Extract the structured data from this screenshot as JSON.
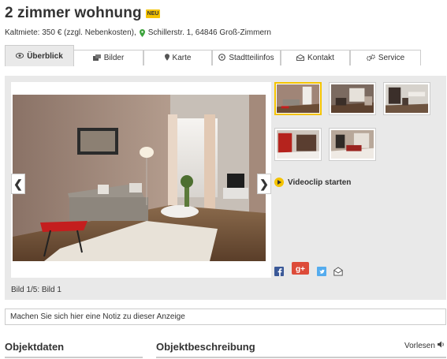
{
  "listing": {
    "title": "2 zimmer wohnung",
    "badge": "NEU",
    "rent_text": "Kaltmiete: 350 € (zzgl. Nebenkosten),",
    "address": "Schillerstr. 1, 64846 Groß-Zimmern"
  },
  "tabs": [
    {
      "label": "Überblick",
      "icon": "eye-icon",
      "active": true
    },
    {
      "label": "Bilder",
      "icon": "images-icon",
      "active": false
    },
    {
      "label": "Karte",
      "icon": "map-pin-icon",
      "active": false
    },
    {
      "label": "Stadtteilinfos",
      "icon": "info-circle-icon",
      "active": false
    },
    {
      "label": "Kontakt",
      "icon": "envelope-icon",
      "active": false
    },
    {
      "label": "Service",
      "icon": "gears-icon",
      "active": false
    }
  ],
  "gallery": {
    "caption": "Bild 1/5: Bild 1",
    "prev_arrow": "❮",
    "next_arrow": "❯",
    "video_label": "Videoclip starten",
    "thumbnail_count": 5,
    "selected_index": 1
  },
  "note": {
    "placeholder": "Machen Sie sich hier eine Notiz zu dieser Anzeige"
  },
  "sections": {
    "left_title": "Objektdaten",
    "right_title": "Objektbeschreibung",
    "read_aloud": "Vorlesen"
  },
  "colors": {
    "accent": "#f4c300",
    "gallery_bg": "#e9e9e9",
    "border": "#cccccc",
    "pin_green": "#3da33d",
    "facebook": "#3b5998",
    "google_plus": "#dd4b39",
    "twitter": "#55acee"
  }
}
